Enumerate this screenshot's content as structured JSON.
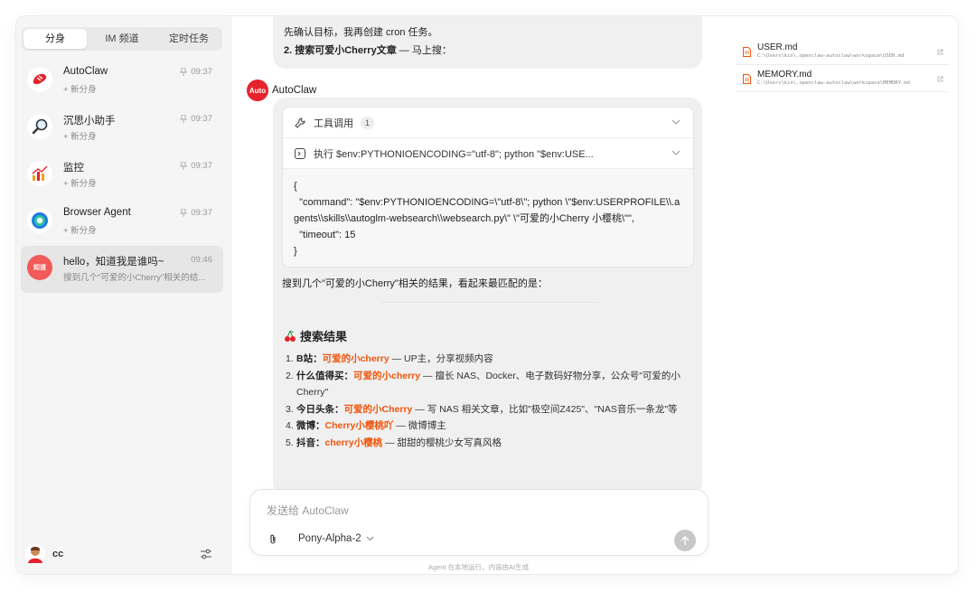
{
  "sidebar": {
    "tabs": [
      {
        "label": "分身",
        "active": true
      },
      {
        "label": "IM 频道",
        "active": false
      },
      {
        "label": "定时任务",
        "active": false
      }
    ],
    "sessions": [
      {
        "name": "AutoClaw",
        "sub": "+ 新分身",
        "time": "09:37",
        "pinned": true,
        "icon": "autoclaw-icon"
      },
      {
        "name": "沉思小助手",
        "sub": "+ 新分身",
        "time": "09:37",
        "pinned": true,
        "icon": "magnifier-icon"
      },
      {
        "name": "监控",
        "sub": "+ 新分身",
        "time": "09:37",
        "pinned": true,
        "icon": "chart-icon"
      },
      {
        "name": "Browser Agent",
        "sub": "+ 新分身",
        "time": "09:37",
        "pinned": true,
        "icon": "browser-icon"
      },
      {
        "name": "hello，知道我是谁吗~",
        "sub": "搜到几个\"可爱的小Cherry\"相关的结...",
        "time": "09:46",
        "pinned": false,
        "icon": "zhidao-icon",
        "avatar_text": "知道"
      }
    ],
    "user": {
      "name": "cc"
    }
  },
  "chat": {
    "user_message": {
      "line1": "先确认目标，我再创建 cron 任务。",
      "line2_bold": "2. 搜索可爱小Cherry文章",
      "line2_rest": " — 马上搜："
    },
    "agent_name": "AutoClaw",
    "agent_logo_text": "Auto",
    "tool_call": {
      "header": "工具调用",
      "count": "1",
      "exec": "执行 $env:PYTHONIOENCODING=\"utf-8\"; python \"$env:USE...",
      "code": "{\n  \"command\": \"$env:PYTHONIOENCODING=\\\"utf-8\\\"; python \\\"$env:USERPROFILE\\\\.agents\\\\skills\\\\autoglm-websearch\\\\websearch.py\\\" \\\"可爱的小Cherry 小樱桃\\\"\",\n  \"timeout\": 15\n}"
    },
    "response": "搜到几个\"可爱的小Cherry\"相关的结果，看起来最匹配的是：",
    "results_title": "搜索结果",
    "results": [
      {
        "num": "1.",
        "platform": "B站：",
        "name": "可爱的小cherry",
        "desc": " — UP主，分享视频内容"
      },
      {
        "num": "2.",
        "platform": "什么值得买：",
        "name": "可爱的小cherry",
        "desc": " — 擅长 NAS、Docker、电子数码好物分享，公众号\"可爱的小Cherry\""
      },
      {
        "num": "3.",
        "platform": "今日头条：",
        "name": "可爱的小Cherry",
        "desc": " — 写 NAS 相关文章，比如\"极空间Z425\"、\"NAS音乐一条龙\"等"
      },
      {
        "num": "4.",
        "platform": "微博：",
        "name": "Cherry小樱桃吖",
        "desc": " — 微博博主"
      },
      {
        "num": "5.",
        "platform": "抖音：",
        "name": "cherry小樱桃",
        "desc": " — 甜甜的樱桃少女写真风格"
      }
    ],
    "input_placeholder": "发送给 AutoClaw",
    "model": "Pony-Alpha-2",
    "footnote": "Agent 在本地运行，内容由AI生成"
  },
  "files": [
    {
      "name": "USER.md",
      "path": "C:\\Users\\kin\\.openclaw-autoclaw\\workspace\\USER.md"
    },
    {
      "name": "MEMORY.md",
      "path": "C:\\Users\\kin\\.openclaw-autoclaw\\workspace\\MEMORY.md"
    }
  ],
  "colors": {
    "accent": "#f0540a",
    "brand": "#e5232b"
  }
}
